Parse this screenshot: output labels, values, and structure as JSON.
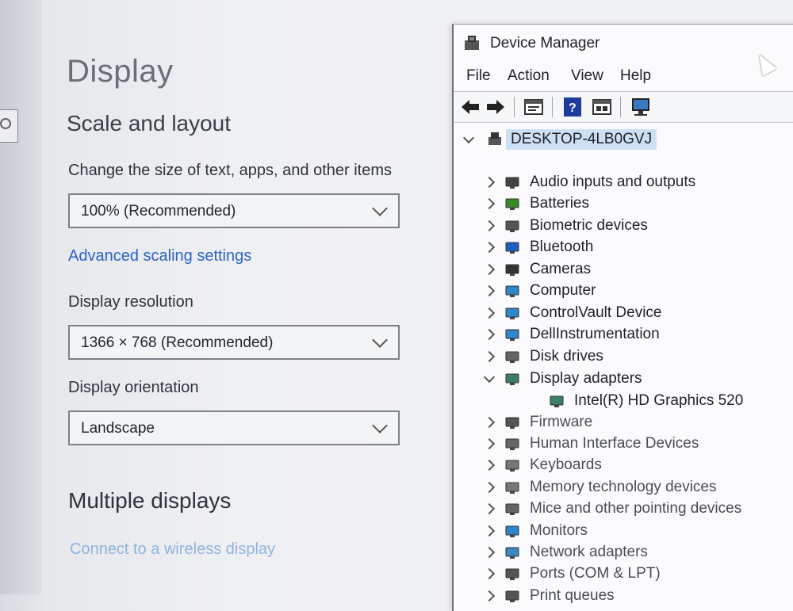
{
  "settings": {
    "title": "Display",
    "scale_heading": "Scale and layout",
    "size_label": "Change the size of text, apps, and other items",
    "size_value": "100% (Recommended)",
    "advanced_link": "Advanced scaling settings",
    "resolution_label": "Display resolution",
    "resolution_value": "1366 × 768 (Recommended)",
    "orientation_label": "Display orientation",
    "orientation_value": "Landscape",
    "multi_heading": "Multiple displays",
    "wireless_link": "Connect to a wireless display"
  },
  "device_manager": {
    "title": "Device Manager",
    "menu": [
      "File",
      "Action",
      "View",
      "Help"
    ],
    "root": "DESKTOP-4LB0GVJ",
    "items": [
      {
        "label": "Audio inputs and outputs",
        "icon": "speaker-icon"
      },
      {
        "label": "Batteries",
        "icon": "battery-icon"
      },
      {
        "label": "Biometric devices",
        "icon": "fingerprint-icon"
      },
      {
        "label": "Bluetooth",
        "icon": "bluetooth-icon"
      },
      {
        "label": "Cameras",
        "icon": "camera-icon"
      },
      {
        "label": "Computer",
        "icon": "computer-icon"
      },
      {
        "label": "ControlVault Device",
        "icon": "monitor-icon"
      },
      {
        "label": "DellInstrumentation",
        "icon": "monitor-icon"
      },
      {
        "label": "Disk drives",
        "icon": "disk-icon"
      },
      {
        "label": "Display adapters",
        "icon": "display-adapter-icon",
        "expanded": true
      },
      {
        "label": "Intel(R) HD Graphics 520",
        "icon": "display-adapter-icon",
        "child": true
      },
      {
        "label": "Firmware",
        "icon": "firmware-icon"
      },
      {
        "label": "Human Interface Devices",
        "icon": "hid-icon"
      },
      {
        "label": "Keyboards",
        "icon": "keyboard-icon"
      },
      {
        "label": "Memory technology devices",
        "icon": "memory-icon"
      },
      {
        "label": "Mice and other pointing devices",
        "icon": "mouse-icon"
      },
      {
        "label": "Monitors",
        "icon": "monitor-icon"
      },
      {
        "label": "Network adapters",
        "icon": "network-icon"
      },
      {
        "label": "Ports (COM & LPT)",
        "icon": "port-icon"
      },
      {
        "label": "Print queues",
        "icon": "printer-icon"
      }
    ]
  }
}
